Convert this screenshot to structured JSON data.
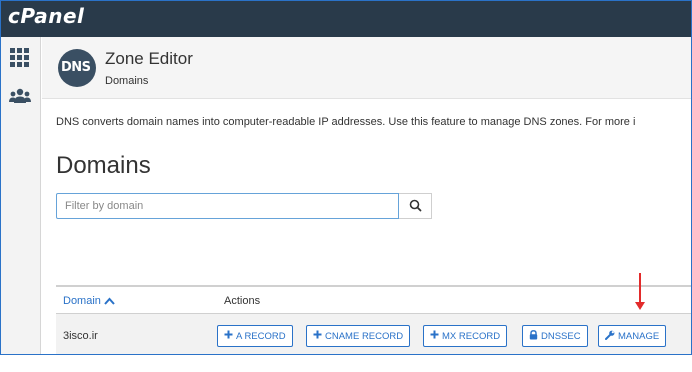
{
  "topbar": {
    "logo_text": "cPanel",
    "bg_color": "#293a4a"
  },
  "sidebar": {
    "items": [
      {
        "icon": "grid-icon"
      },
      {
        "icon": "users-icon"
      }
    ]
  },
  "header": {
    "badge_text": "DNS",
    "title": "Zone Editor",
    "breadcrumb": "Domains"
  },
  "description": "DNS converts domain names into computer-readable IP addresses. Use this feature to manage DNS zones. For more i",
  "section_title": "Domains",
  "search": {
    "placeholder": "Filter by domain",
    "value": "",
    "icon": "search-icon"
  },
  "table": {
    "columns": {
      "domain": "Domain",
      "actions": "Actions"
    },
    "sort": {
      "column": "domain",
      "direction": "ascending"
    },
    "rows": [
      {
        "domain": "3isco.ir",
        "actions": {
          "a_record": "A RECORD",
          "cname_record": "CNAME RECORD",
          "mx_record": "MX RECORD",
          "dnssec": "DNSSEC",
          "manage": "MANAGE"
        }
      }
    ]
  },
  "colors": {
    "accent": "#2a72c8",
    "annotation_arrow": "#e22b2b"
  }
}
